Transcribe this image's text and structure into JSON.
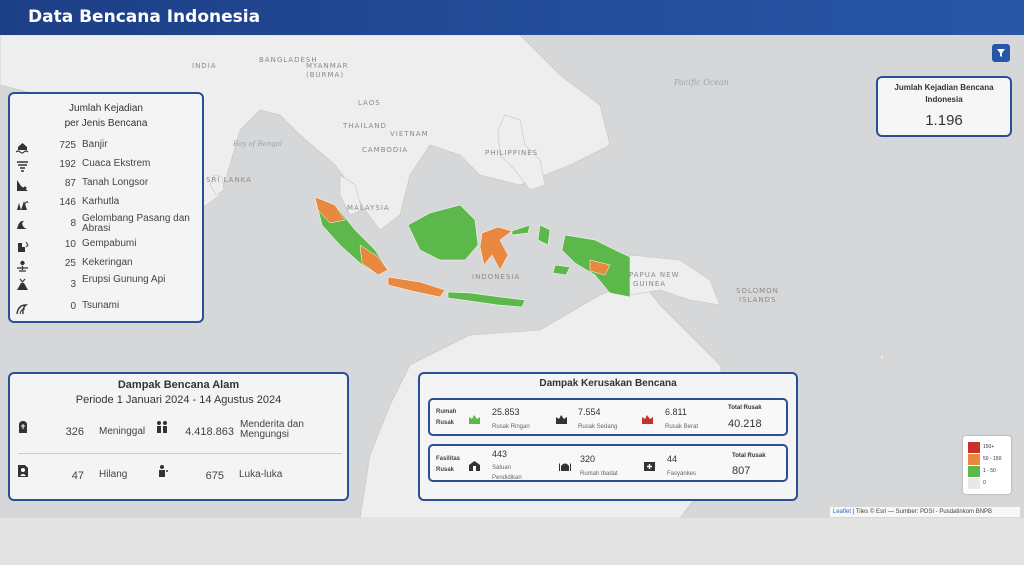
{
  "header": {
    "title": "Data Bencana Indonesia"
  },
  "map": {
    "labels": [
      {
        "text": "INDIA"
      },
      {
        "text": "BANGLADESH"
      },
      {
        "text": "MYANMAR"
      },
      {
        "text": "(BURMA)"
      },
      {
        "text": "LAOS"
      },
      {
        "text": "THAILAND"
      },
      {
        "text": "VIETNAM"
      },
      {
        "text": "CAMBODIA"
      },
      {
        "text": "PHILIPPINES"
      },
      {
        "text": "SRI LANKA"
      },
      {
        "text": "MALAYSIA"
      },
      {
        "text": "INDONESIA"
      },
      {
        "text": "PAPUA NEW"
      },
      {
        "text": "GUINEA"
      },
      {
        "text": "SOLOMON"
      },
      {
        "text": "ISLANDS"
      }
    ],
    "seas": [
      {
        "text": "Pacific Ocean"
      },
      {
        "text": "Bay of Bengal"
      }
    ],
    "region_colors": {
      "high": "#e8893f",
      "medium": "#5cb84a",
      "low": "#d0d0d0"
    }
  },
  "jenis_bencana": {
    "title_line1": "Jumlah Kejadian",
    "title_line2": "per Jenis Bencana",
    "items": [
      {
        "icon": "flood-icon",
        "count": "725",
        "label": "Banjir"
      },
      {
        "icon": "tornado-icon",
        "count": "192",
        "label": "Cuaca Ekstrem"
      },
      {
        "icon": "landslide-icon",
        "count": "87",
        "label": "Tanah Longsor"
      },
      {
        "icon": "forest-fire-icon",
        "count": "146",
        "label": "Karhutla"
      },
      {
        "icon": "wave-icon",
        "count": "8",
        "label": "Gelombang Pasang dan Abrasi"
      },
      {
        "icon": "earthquake-icon",
        "count": "10",
        "label": "Gempabumi"
      },
      {
        "icon": "drought-icon",
        "count": "25",
        "label": "Kekeringan"
      },
      {
        "icon": "volcano-icon",
        "count": "3",
        "label": "Erupsi Gunung Api"
      },
      {
        "icon": "tsunami-icon",
        "count": "0",
        "label": "Tsunami"
      }
    ]
  },
  "kejadian": {
    "title": "Jumlah Kejadian Bencana Indonesia",
    "value": "1.196"
  },
  "dampak": {
    "title": "Dampak Bencana Alam",
    "period": "Periode 1 Januari 2024 - 14 Agustus 2024",
    "meninggal": {
      "value": "326",
      "label": "Meninggal"
    },
    "menderita": {
      "value": "4.418.863",
      "label": "Menderita dan Mengungsi"
    },
    "hilang": {
      "value": "47",
      "label": "Hilang"
    },
    "luka": {
      "value": "675",
      "label": "Luka-luka"
    }
  },
  "kerusakan": {
    "title": "Dampak Kerusakan Bencana",
    "rumah": {
      "label_line1": "Rumah",
      "label_line2": "Rusak",
      "ringan": {
        "value": "25.853",
        "label": "Rusak Ringan"
      },
      "sedang": {
        "value": "7.554",
        "label": "Rusak Sedang"
      },
      "berat": {
        "value": "6.811",
        "label": "Rusak Berat"
      },
      "total_label": "Total Rusak",
      "total": "40.218"
    },
    "fasilitas": {
      "label_line1": "Fasilitas",
      "label_line2": "Rusak",
      "pendidikan": {
        "value": "443",
        "label_line1": "Satuan",
        "label_line2": "Pendidikan"
      },
      "ibadat": {
        "value": "320",
        "label": "Rumah Ibadat"
      },
      "fasyankes": {
        "value": "44",
        "label": "Fasyankes"
      },
      "total_label": "Total Rusak",
      "total": "807"
    }
  },
  "legend": {
    "items": [
      {
        "label": "150+",
        "color": "#c9302c"
      },
      {
        "label": "50 - 150",
        "color": "#e8893f"
      },
      {
        "label": "1 - 50",
        "color": "#5cb84a"
      },
      {
        "label": "0",
        "color": "#e8e8e8"
      }
    ]
  },
  "attribution": {
    "leaflet": "Leaflet",
    "rest": " | Tiles © Esri — Sumber: PDSI - Pusdatinkom BNPB"
  }
}
